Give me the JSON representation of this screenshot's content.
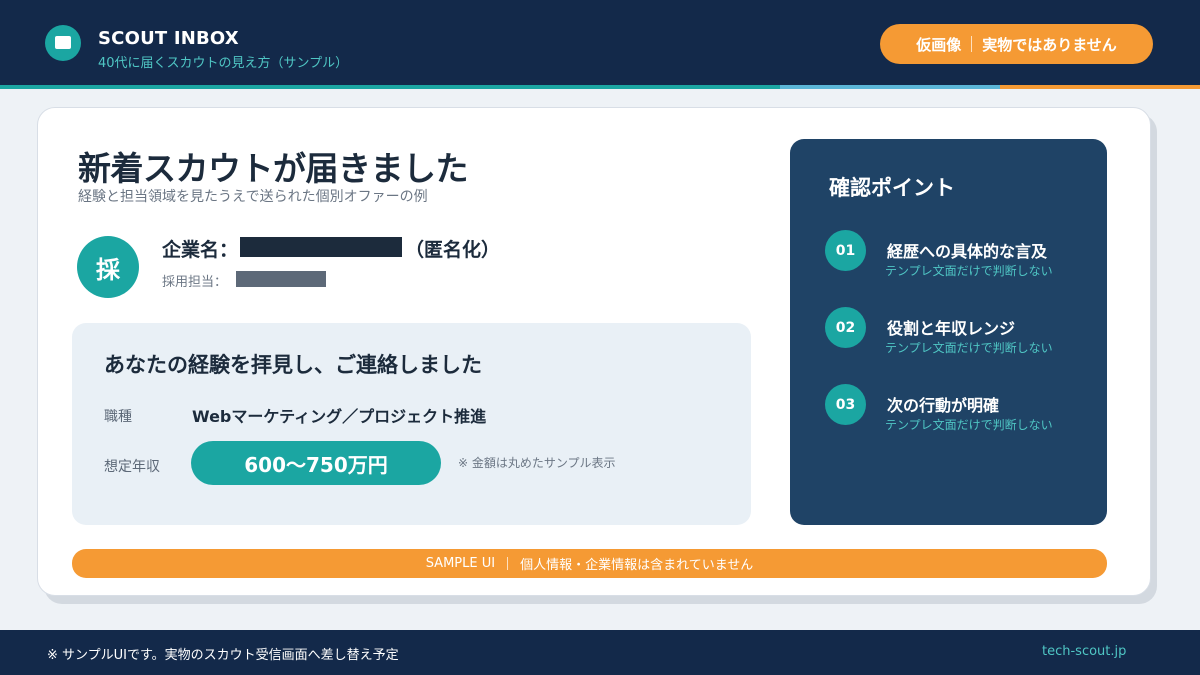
{
  "header": {
    "icon": "mail-icon",
    "title": "SCOUT INBOX",
    "subtitle": "40代に届くスカウトの見え方（サンプル）",
    "badge_left": "仮画像",
    "badge_right": "実物ではありません"
  },
  "card": {
    "title": "新着スカウトが届きました",
    "subtitle": "経験と担当領域を見たうえで送られた個別オファーの例",
    "avatar_char": "採",
    "company_label": "企業名：",
    "company_anon": "（匿名化）",
    "recruiter_label": "採用担当：",
    "message": {
      "heading": "あなたの経験を拝見し、ご連絡しました",
      "job_label": "職種",
      "job_value": "Webマーケティング／プロジェクト推進",
      "salary_label": "想定年収",
      "salary_value": "600〜750万円",
      "salary_note": "※ 金額は丸めたサンプル表示"
    }
  },
  "checkpoints": {
    "title": "確認ポイント",
    "items": [
      {
        "num": "01",
        "title": "経歴への具体的な言及",
        "sub": "テンプレ文面だけで判断しない"
      },
      {
        "num": "02",
        "title": "役割と年収レンジ",
        "sub": "テンプレ文面だけで判断しない"
      },
      {
        "num": "03",
        "title": "次の行動が明確",
        "sub": "テンプレ文面だけで判断しない"
      }
    ]
  },
  "banner": {
    "left": "SAMPLE UI",
    "right": "個人情報・企業情報は含まれていません"
  },
  "footer": {
    "note": "※ サンプルUIです。実物のスカウト受信画面へ差し替え予定",
    "url": "tech-scout.jp"
  },
  "colors": {
    "navy": "#13294a",
    "panel": "#1f4366",
    "teal": "#1ba6a2",
    "orange": "#f59a34"
  }
}
